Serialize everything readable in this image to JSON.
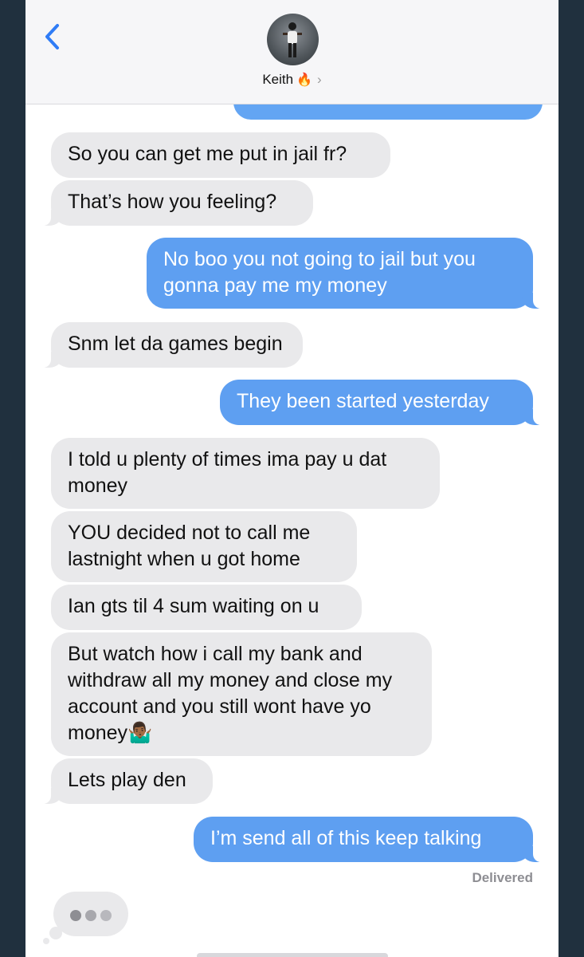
{
  "header": {
    "contact_name": "Keith",
    "contact_emoji": "🔥",
    "chevron": "›",
    "back_icon": "chevron-left-icon"
  },
  "messages": [
    {
      "side": "in",
      "text": "So you can get me put in jail fr?"
    },
    {
      "side": "in",
      "text": "That’s how you feeling?"
    },
    {
      "side": "out",
      "text": "No boo you not going to jail but you gonna pay me my money"
    },
    {
      "side": "in",
      "text": "Snm let da games begin"
    },
    {
      "side": "out",
      "text": "They been started yesterday"
    },
    {
      "side": "in",
      "text": "I told u plenty of times ima pay u dat money"
    },
    {
      "side": "in",
      "text": "YOU decided not to call me lastnight when u got home"
    },
    {
      "side": "in",
      "text": "Ian gts til 4 sum waiting on u"
    },
    {
      "side": "in",
      "text": "But watch how i call my bank and withdraw all my money and close my account and you still wont have yo money🤷🏾‍♂️"
    },
    {
      "side": "in",
      "text": "Lets play den"
    },
    {
      "side": "out",
      "text": "I’m send all of this keep talking"
    }
  ],
  "status": "Delivered",
  "colors": {
    "incoming_bubble": "#e9e9eb",
    "outgoing_bubble": "#5e9ff1",
    "header_bg": "#f6f6f8",
    "frame_bg": "#20303e"
  }
}
